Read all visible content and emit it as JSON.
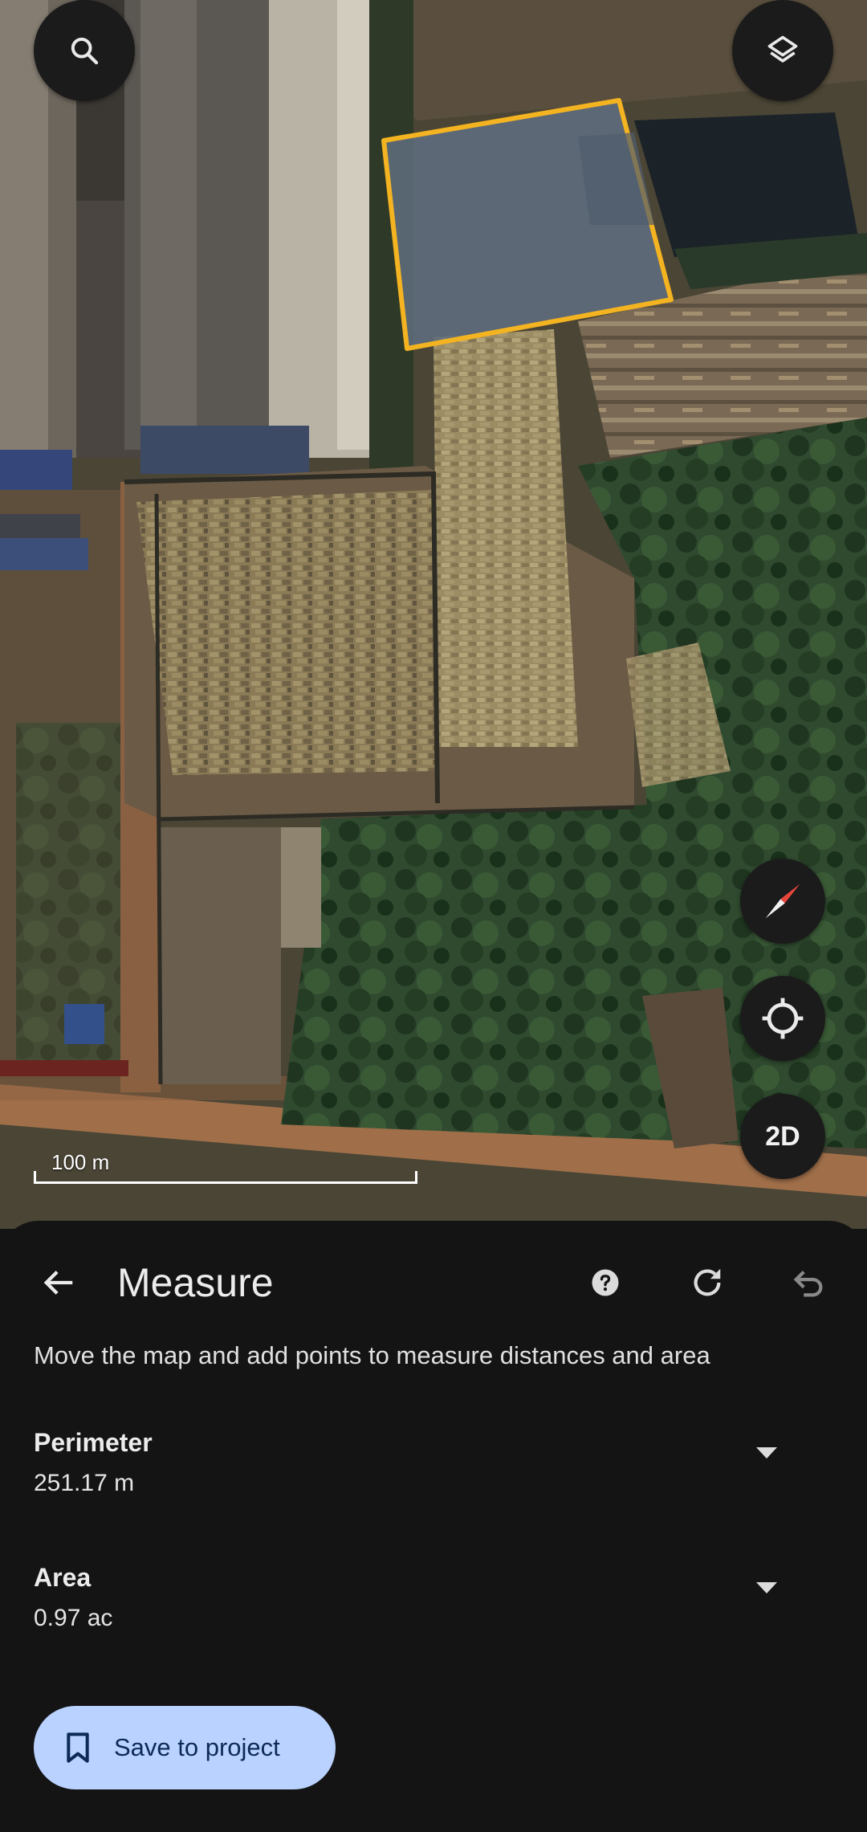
{
  "map": {
    "scale_label": "100 m",
    "mode_label": "2D",
    "accent_color": "#f4b321"
  },
  "sheet": {
    "title": "Measure",
    "instruction": "Move the map and add points to measure distances and area",
    "perimeter": {
      "label": "Perimeter",
      "value": "251.17 m"
    },
    "area": {
      "label": "Area",
      "value": "0.97 ac"
    },
    "save_label": "Save to project"
  },
  "icons": [
    "search-icon",
    "layers-icon",
    "compass-icon",
    "my-location-icon",
    "back-arrow-icon",
    "help-icon",
    "reset-icon",
    "undo-icon",
    "chevron-down-icon",
    "bookmark-icon"
  ]
}
